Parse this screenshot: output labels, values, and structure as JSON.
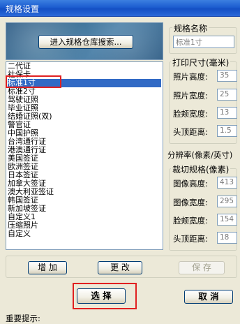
{
  "window": {
    "title": "规格设置"
  },
  "banner": {
    "warehouse_button": "进入规格仓库搜索..."
  },
  "spec_list": {
    "items": [
      "二代证",
      "社保卡",
      "标准1寸",
      "标准2寸",
      "驾驶证照",
      "毕业证照",
      "结婚证照(双)",
      "警官证",
      "中国护照",
      "台湾通行证",
      "港澳通行证",
      "美国签证",
      "欧洲签证",
      "日本签证",
      "加拿大签证",
      "澳大利亚签证",
      "韩国签证",
      "新加坡签证",
      "自定义1",
      "压缩照片",
      "自定义"
    ],
    "selected": "标准1寸"
  },
  "spec_name": {
    "legend": "规格名称",
    "value": "标准1寸"
  },
  "print_size": {
    "legend": "打印尺寸(毫米)",
    "rows": [
      {
        "label": "照片高度:",
        "value": "35"
      },
      {
        "label": "照片宽度:",
        "value": "25"
      },
      {
        "label": "脸颊宽度:",
        "value": "13"
      },
      {
        "label": "头顶距离:",
        "value": "1.5"
      }
    ]
  },
  "resolution": {
    "label": "分辨率(像素/英寸)"
  },
  "crop_spec": {
    "legend": "裁切规格(像素)",
    "rows": [
      {
        "label": "图像高度:",
        "value": "413"
      },
      {
        "label": "图像宽度:",
        "value": "295"
      },
      {
        "label": "脸颊宽度:",
        "value": "154"
      },
      {
        "label": "头顶距离:",
        "value": "18"
      }
    ]
  },
  "actions": {
    "add": "增 加",
    "edit": "更 改",
    "save": "保 存",
    "select": "选 择",
    "cancel": "取 消"
  },
  "footer": {
    "hint": "重要提示:"
  },
  "colors": {
    "title_bar": "#1C5DD0",
    "selection": "#316AC5",
    "highlight_box": "#E02020",
    "dialog_bg": "#ECE9D8"
  }
}
